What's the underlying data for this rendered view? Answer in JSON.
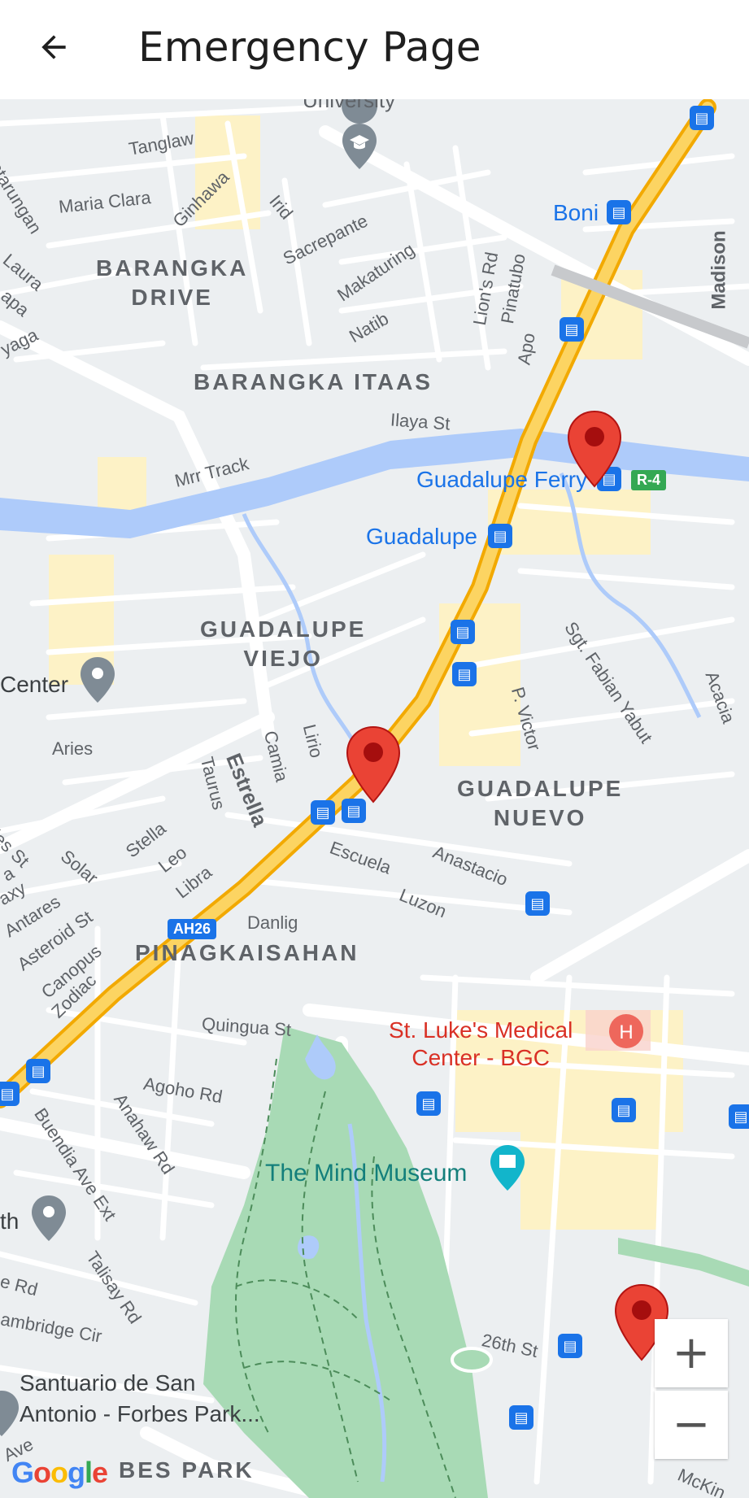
{
  "header": {
    "title": "Emergency Page",
    "back_icon": "arrow-left-icon"
  },
  "map": {
    "areas": {
      "barangka_drive": "BARANGKA\nDRIVE",
      "barangka_itaas": "BARANGKA ITAAS",
      "guadalupe_viejo": "GUADALUPE\nVIEJO",
      "guadalupe_nuevo": "GUADALUPE\nNUEVO",
      "pinagkaisahan": "PINAGKAISAHAN",
      "bes_park": "BES PARK"
    },
    "streets": {
      "university": "University",
      "katarungan": "Katarungan",
      "tanglaw": "Tanglaw",
      "maria_clara": "Maria Clara",
      "ginhawa": "Ginhawa",
      "irid": "Irid",
      "sacrepante": "Sacrepante",
      "makaturing": "Makaturing",
      "natib": "Natib",
      "lions_rd": "Lion's Rd",
      "pinatubo": "Pinatubo",
      "apo": "Apo",
      "madison": "Madison",
      "laura": "Laura",
      "apa": "apa",
      "yaga": "yaga",
      "ilaya": "Ilaya St",
      "mrr_track": "Mrr Track",
      "sgt_fabian": "Sgt. Fabian Yabut",
      "acacia": "Acacia",
      "p_victor": "P. Victor",
      "aries": "Aries",
      "taurus": "Taurus",
      "camia": "Camia",
      "lirio": "Lirio",
      "estrella": "Estrella",
      "stella": "Stella",
      "leo": "Leo",
      "libra": "Libra",
      "solar": "Solar",
      "des_st": "des St",
      "axy": "axy",
      "a": "a",
      "antares": "Antares",
      "asteroid": "Asteroid St",
      "canopus": "Canopus",
      "zodiac": "Zodiac",
      "escuela": "Escuela",
      "anastacio": "Anastacio",
      "luzon": "Luzon",
      "danlig": "Danlig",
      "quingua": "Quingua St",
      "agoho": "Agoho Rd",
      "anahaw": "Anahaw Rd",
      "buendia": "Buendia Ave Ext",
      "talisay": "Talisay Rd",
      "e_rd": "e Rd",
      "cambridge": "ambridge Cir",
      "26th": "26th St",
      "mckinley": "McKin",
      "ave": "Ave"
    },
    "pois": {
      "boni": "Boni",
      "guadalupe_ferry": "Guadalupe Ferry",
      "guadalupe": "Guadalupe",
      "center": "Center",
      "st_lukes": "St. Luke's Medical\nCenter - BGC",
      "mind_museum": "The Mind Museum",
      "th": "th",
      "santuario": "Santuario de San\nAntonio - Forbes Park..."
    },
    "route_shields": {
      "ah26": "AH26",
      "r4": "R-4"
    },
    "transit_glyph": "▤",
    "hospital_glyph": "H",
    "zoom_in": "+",
    "zoom_out": "−",
    "google_logo": [
      "G",
      "o",
      "o",
      "g",
      "l",
      "e"
    ],
    "colors": {
      "marker": "#ea4335",
      "water": "#aecbfa",
      "park": "#a8dab5",
      "highway": "#f9c846",
      "transit": "#1a73e8"
    }
  }
}
